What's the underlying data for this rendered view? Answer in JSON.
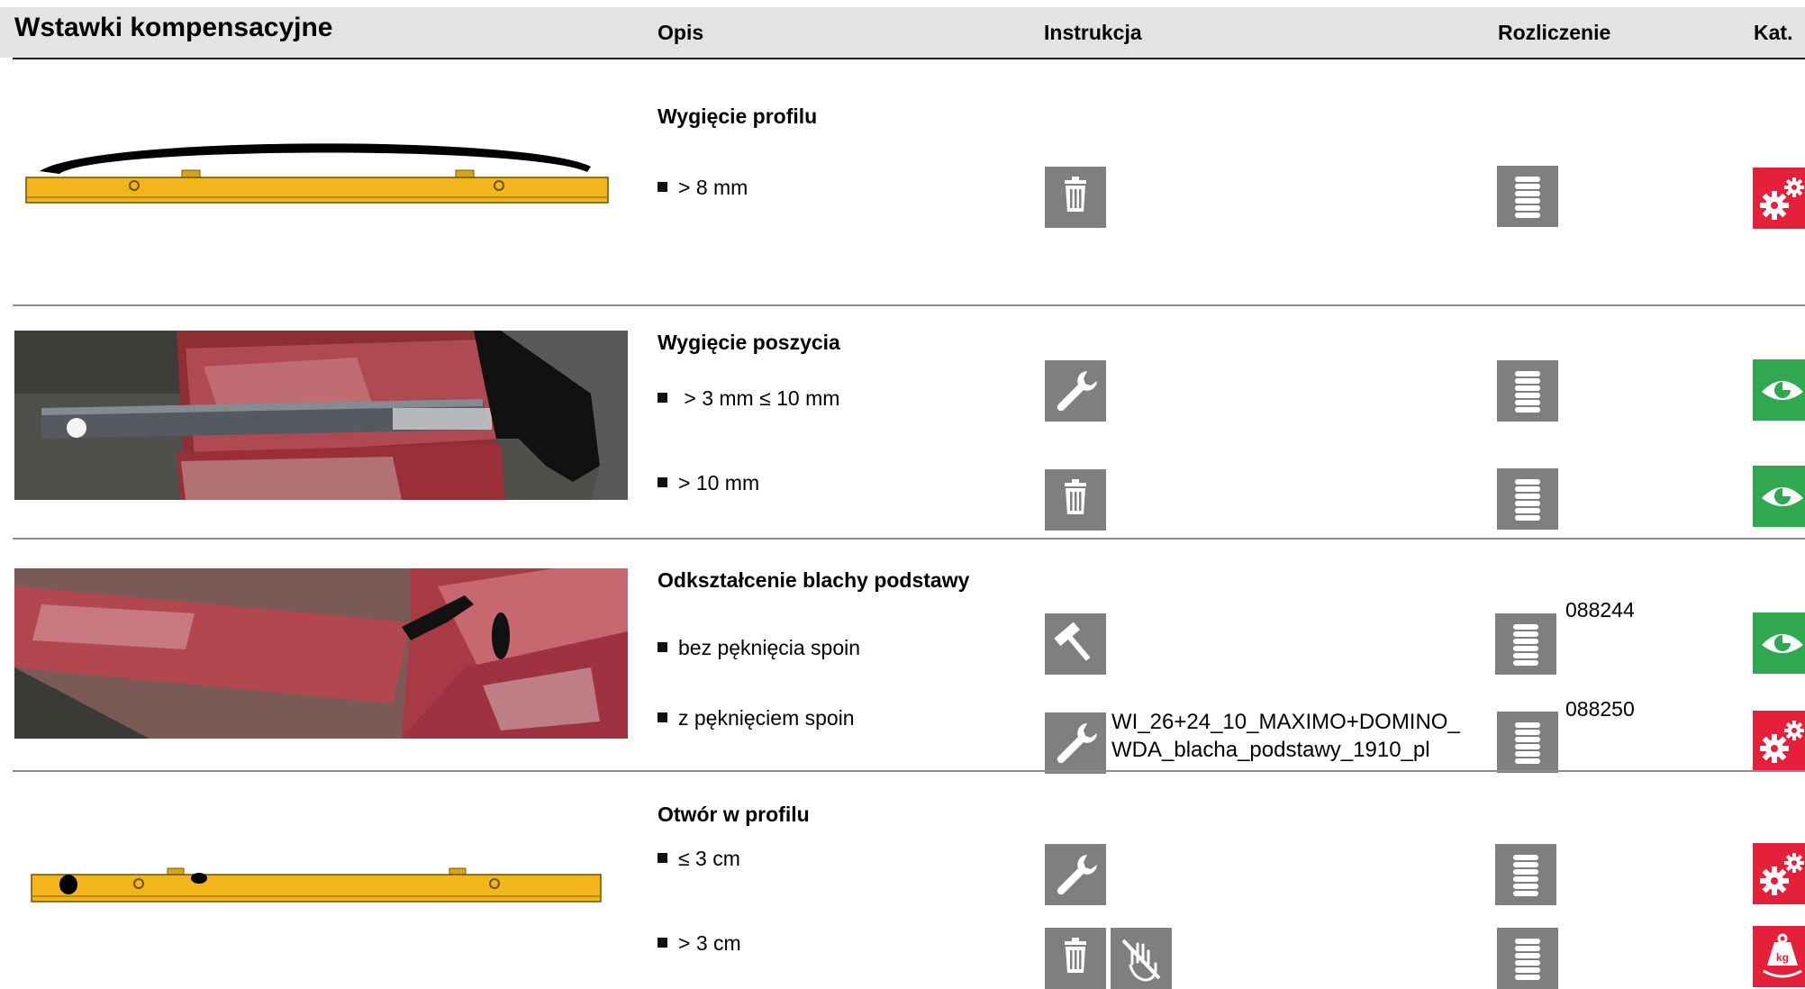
{
  "header": {
    "title": "Wstawki kompensacyjne",
    "col_opis": "Opis",
    "col_instrukcja": "Instrukcja",
    "col_rozliczenie": "Rozliczenie",
    "col_kat": "Kat."
  },
  "sections": [
    {
      "title": "Wygięcie profilu",
      "items": [
        {
          "text": "> 8 mm",
          "instruction_icons": [
            "trash-icon"
          ],
          "billing_icon": "coin-stack-icon",
          "category": "repair-gears",
          "category_color": "#e5203a"
        }
      ]
    },
    {
      "title": "Wygięcie poszycia",
      "items": [
        {
          "text": " > 3 mm ≤ 10 mm",
          "instruction_icons": [
            "wrench-icon"
          ],
          "billing_icon": "coin-stack-icon",
          "category": "inspect-eye",
          "category_color": "#2fa84f"
        },
        {
          "text": "> 10 mm",
          "instruction_icons": [
            "trash-icon"
          ],
          "billing_icon": "coin-stack-icon",
          "category": "inspect-eye",
          "category_color": "#2fa84f"
        }
      ]
    },
    {
      "title": "Odkształcenie blachy podstawy",
      "items": [
        {
          "text": "bez pęknięcia spoin",
          "instruction_icons": [
            "hammer-icon"
          ],
          "billing_icon": "coin-stack-icon",
          "billing_code": "088244",
          "category": "inspect-eye",
          "category_color": "#2fa84f"
        },
        {
          "text": "z pęknięciem spoin",
          "instruction_icons": [
            "wrench-icon"
          ],
          "instruction_doc_line1": "WI_26+24_10_MAXIMO+DOMINO_",
          "instruction_doc_line2": "WDA_blacha_podstawy_1910_pl",
          "billing_icon": "coin-stack-icon",
          "billing_code": "088250",
          "category": "repair-gears",
          "category_color": "#e5203a"
        }
      ]
    },
    {
      "title": "Otwór w profilu",
      "items": [
        {
          "text": "≤ 3 cm",
          "instruction_icons": [
            "wrench-icon"
          ],
          "billing_icon": "coin-stack-icon",
          "category": "repair-gears",
          "category_color": "#e5203a"
        },
        {
          "text": "> 3 cm",
          "instruction_icons": [
            "trash-icon",
            "no-hand-icon"
          ],
          "billing_icon": "coin-stack-icon",
          "category": "weight-kg",
          "category_color": "#e5203a"
        }
      ]
    }
  ]
}
